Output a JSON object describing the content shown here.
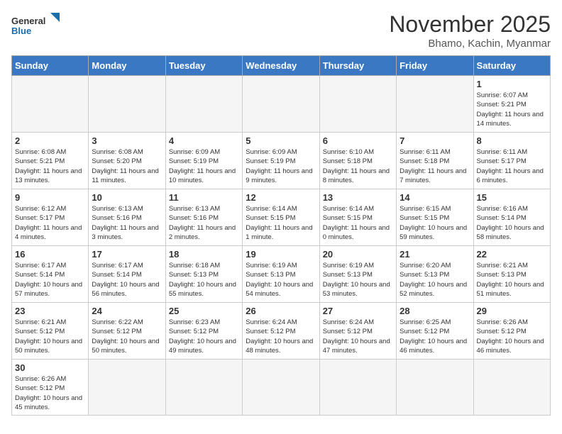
{
  "logo": {
    "text_general": "General",
    "text_blue": "Blue"
  },
  "title": "November 2025",
  "subtitle": "Bhamo, Kachin, Myanmar",
  "days_of_week": [
    "Sunday",
    "Monday",
    "Tuesday",
    "Wednesday",
    "Thursday",
    "Friday",
    "Saturday"
  ],
  "weeks": [
    [
      {
        "day": "",
        "info": ""
      },
      {
        "day": "",
        "info": ""
      },
      {
        "day": "",
        "info": ""
      },
      {
        "day": "",
        "info": ""
      },
      {
        "day": "",
        "info": ""
      },
      {
        "day": "",
        "info": ""
      },
      {
        "day": "1",
        "info": "Sunrise: 6:07 AM\nSunset: 5:21 PM\nDaylight: 11 hours\nand 14 minutes."
      }
    ],
    [
      {
        "day": "2",
        "info": "Sunrise: 6:08 AM\nSunset: 5:21 PM\nDaylight: 11 hours\nand 13 minutes."
      },
      {
        "day": "3",
        "info": "Sunrise: 6:08 AM\nSunset: 5:20 PM\nDaylight: 11 hours\nand 11 minutes."
      },
      {
        "day": "4",
        "info": "Sunrise: 6:09 AM\nSunset: 5:19 PM\nDaylight: 11 hours\nand 10 minutes."
      },
      {
        "day": "5",
        "info": "Sunrise: 6:09 AM\nSunset: 5:19 PM\nDaylight: 11 hours\nand 9 minutes."
      },
      {
        "day": "6",
        "info": "Sunrise: 6:10 AM\nSunset: 5:18 PM\nDaylight: 11 hours\nand 8 minutes."
      },
      {
        "day": "7",
        "info": "Sunrise: 6:11 AM\nSunset: 5:18 PM\nDaylight: 11 hours\nand 7 minutes."
      },
      {
        "day": "8",
        "info": "Sunrise: 6:11 AM\nSunset: 5:17 PM\nDaylight: 11 hours\nand 6 minutes."
      }
    ],
    [
      {
        "day": "9",
        "info": "Sunrise: 6:12 AM\nSunset: 5:17 PM\nDaylight: 11 hours\nand 4 minutes."
      },
      {
        "day": "10",
        "info": "Sunrise: 6:13 AM\nSunset: 5:16 PM\nDaylight: 11 hours\nand 3 minutes."
      },
      {
        "day": "11",
        "info": "Sunrise: 6:13 AM\nSunset: 5:16 PM\nDaylight: 11 hours\nand 2 minutes."
      },
      {
        "day": "12",
        "info": "Sunrise: 6:14 AM\nSunset: 5:15 PM\nDaylight: 11 hours\nand 1 minute."
      },
      {
        "day": "13",
        "info": "Sunrise: 6:14 AM\nSunset: 5:15 PM\nDaylight: 11 hours\nand 0 minutes."
      },
      {
        "day": "14",
        "info": "Sunrise: 6:15 AM\nSunset: 5:15 PM\nDaylight: 10 hours\nand 59 minutes."
      },
      {
        "day": "15",
        "info": "Sunrise: 6:16 AM\nSunset: 5:14 PM\nDaylight: 10 hours\nand 58 minutes."
      }
    ],
    [
      {
        "day": "16",
        "info": "Sunrise: 6:17 AM\nSunset: 5:14 PM\nDaylight: 10 hours\nand 57 minutes."
      },
      {
        "day": "17",
        "info": "Sunrise: 6:17 AM\nSunset: 5:14 PM\nDaylight: 10 hours\nand 56 minutes."
      },
      {
        "day": "18",
        "info": "Sunrise: 6:18 AM\nSunset: 5:13 PM\nDaylight: 10 hours\nand 55 minutes."
      },
      {
        "day": "19",
        "info": "Sunrise: 6:19 AM\nSunset: 5:13 PM\nDaylight: 10 hours\nand 54 minutes."
      },
      {
        "day": "20",
        "info": "Sunrise: 6:19 AM\nSunset: 5:13 PM\nDaylight: 10 hours\nand 53 minutes."
      },
      {
        "day": "21",
        "info": "Sunrise: 6:20 AM\nSunset: 5:13 PM\nDaylight: 10 hours\nand 52 minutes."
      },
      {
        "day": "22",
        "info": "Sunrise: 6:21 AM\nSunset: 5:13 PM\nDaylight: 10 hours\nand 51 minutes."
      }
    ],
    [
      {
        "day": "23",
        "info": "Sunrise: 6:21 AM\nSunset: 5:12 PM\nDaylight: 10 hours\nand 50 minutes."
      },
      {
        "day": "24",
        "info": "Sunrise: 6:22 AM\nSunset: 5:12 PM\nDaylight: 10 hours\nand 50 minutes."
      },
      {
        "day": "25",
        "info": "Sunrise: 6:23 AM\nSunset: 5:12 PM\nDaylight: 10 hours\nand 49 minutes."
      },
      {
        "day": "26",
        "info": "Sunrise: 6:24 AM\nSunset: 5:12 PM\nDaylight: 10 hours\nand 48 minutes."
      },
      {
        "day": "27",
        "info": "Sunrise: 6:24 AM\nSunset: 5:12 PM\nDaylight: 10 hours\nand 47 minutes."
      },
      {
        "day": "28",
        "info": "Sunrise: 6:25 AM\nSunset: 5:12 PM\nDaylight: 10 hours\nand 46 minutes."
      },
      {
        "day": "29",
        "info": "Sunrise: 6:26 AM\nSunset: 5:12 PM\nDaylight: 10 hours\nand 46 minutes."
      }
    ],
    [
      {
        "day": "30",
        "info": "Sunrise: 6:26 AM\nSunset: 5:12 PM\nDaylight: 10 hours\nand 45 minutes."
      },
      {
        "day": "",
        "info": ""
      },
      {
        "day": "",
        "info": ""
      },
      {
        "day": "",
        "info": ""
      },
      {
        "day": "",
        "info": ""
      },
      {
        "day": "",
        "info": ""
      },
      {
        "day": "",
        "info": ""
      }
    ]
  ]
}
